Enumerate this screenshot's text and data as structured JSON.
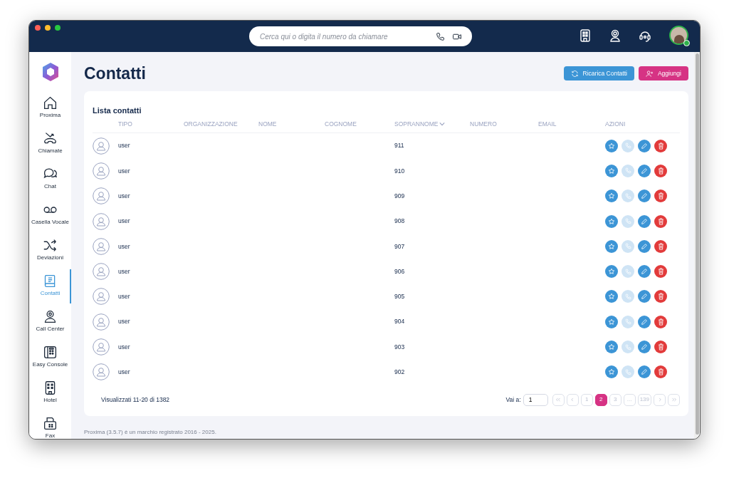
{
  "topbar": {
    "search": {
      "placeholder": "Cerca qui o digita il numero da chiamare"
    },
    "user": {
      "online": true
    }
  },
  "sidebar": {
    "items": [
      {
        "kind": "home",
        "label": "Proxima",
        "selected": false
      },
      {
        "kind": "calls",
        "label": "Chiamate",
        "selected": false
      },
      {
        "kind": "chat",
        "label": "Chat",
        "selected": false
      },
      {
        "kind": "voicemail",
        "label": "Casella Vocale",
        "selected": false
      },
      {
        "kind": "forward",
        "label": "Deviazioni",
        "selected": false
      },
      {
        "kind": "contacts",
        "label": "Contatti",
        "selected": true
      },
      {
        "kind": "callcenter",
        "label": "Call Center",
        "selected": false
      },
      {
        "kind": "console",
        "label": "Easy Console",
        "selected": false
      },
      {
        "kind": "hotel",
        "label": "Hotel",
        "selected": false
      },
      {
        "kind": "fax",
        "label": "Fax",
        "selected": false
      }
    ]
  },
  "page": {
    "title": "Contatti",
    "buttons": [
      {
        "kind": "reload",
        "label": "Ricarica Contatti"
      },
      {
        "kind": "add",
        "label": "Aggiungi"
      }
    ]
  },
  "table": {
    "title": "Lista contatti",
    "columns": [
      {
        "label": "TIPO",
        "sorted": false
      },
      {
        "label": "ORGANIZZAZIONE",
        "sorted": false
      },
      {
        "label": "NOME",
        "sorted": false
      },
      {
        "label": "COGNOME",
        "sorted": false
      },
      {
        "label": "SOPRANNOME",
        "sorted": true
      },
      {
        "label": "NUMERO",
        "sorted": false
      },
      {
        "label": "EMAIL",
        "sorted": false
      },
      {
        "label": "AZIONI",
        "sorted": false
      }
    ],
    "rows": [
      {
        "type": "user",
        "nickname": "911",
        "call_disabled": true
      },
      {
        "type": "user",
        "nickname": "910",
        "call_disabled": true
      },
      {
        "type": "user",
        "nickname": "909",
        "call_disabled": true
      },
      {
        "type": "user",
        "nickname": "908",
        "call_disabled": true
      },
      {
        "type": "user",
        "nickname": "907",
        "call_disabled": true
      },
      {
        "type": "user",
        "nickname": "906",
        "call_disabled": true
      },
      {
        "type": "user",
        "nickname": "905",
        "call_disabled": true
      },
      {
        "type": "user",
        "nickname": "904",
        "call_disabled": true
      },
      {
        "type": "user",
        "nickname": "903",
        "call_disabled": true
      },
      {
        "type": "user",
        "nickname": "902",
        "call_disabled": true
      }
    ],
    "summary": "Visualizzati 11-20 di 1382",
    "goto": {
      "label": "Vai a:",
      "value": "1"
    },
    "pages": [
      {
        "kind": "first",
        "selected": false
      },
      {
        "kind": "prev",
        "selected": false
      },
      {
        "kind": "page",
        "label": "1",
        "selected": false
      },
      {
        "kind": "page",
        "label": "2",
        "selected": true
      },
      {
        "kind": "page",
        "label": "3",
        "selected": false
      },
      {
        "kind": "page",
        "label": "...",
        "selected": false
      },
      {
        "kind": "page",
        "label": "139",
        "selected": false
      },
      {
        "kind": "next",
        "selected": false
      },
      {
        "kind": "last",
        "selected": false
      }
    ]
  },
  "footer": "Proxima (3.5.7) è un marchio registrato 2016 - 2025."
}
